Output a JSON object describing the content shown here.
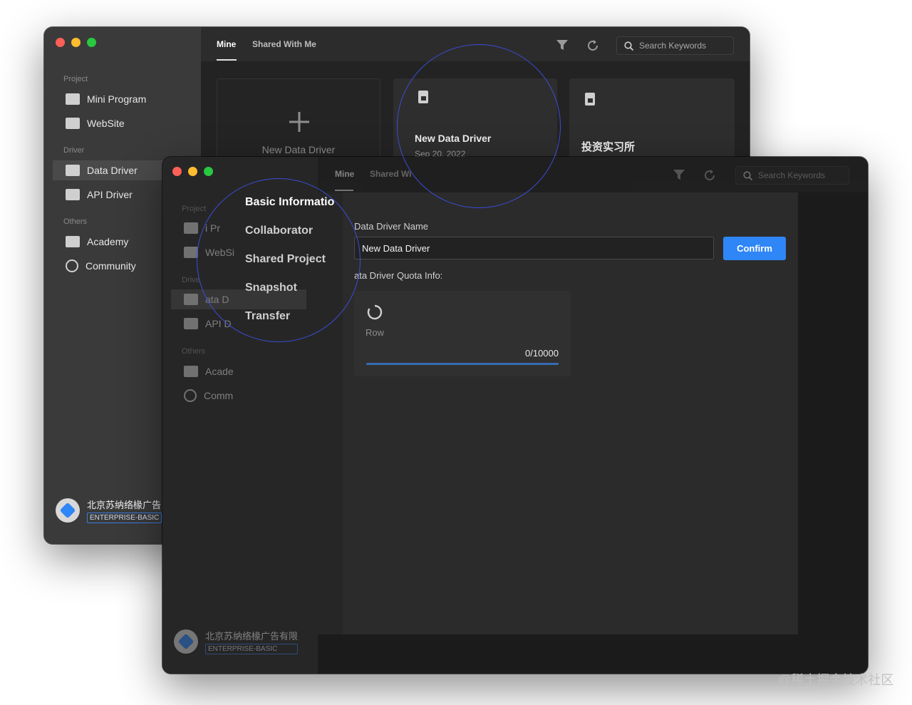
{
  "back_window": {
    "sidebar": {
      "sections": [
        {
          "title": "Project",
          "items": [
            {
              "label": "Mini Program",
              "icon": "mini-program-icon"
            },
            {
              "label": "WebSite",
              "icon": "website-icon"
            }
          ]
        },
        {
          "title": "Driver",
          "items": [
            {
              "label": "Data Driver",
              "icon": "data-driver-icon",
              "active": true
            },
            {
              "label": "API Driver",
              "icon": "api-driver-icon"
            }
          ]
        },
        {
          "title": "Others",
          "items": [
            {
              "label": "Academy",
              "icon": "academy-icon"
            },
            {
              "label": "Community",
              "icon": "community-icon"
            }
          ]
        }
      ],
      "brand": {
        "name": "北京苏纳络椽广告",
        "badge": "ENTERPRISE-BASIC"
      }
    },
    "tabs": [
      {
        "label": "Mine",
        "active": true
      },
      {
        "label": "Shared With Me"
      }
    ],
    "search_placeholder": "Search Keywords",
    "cards": {
      "new_card_label": "New Data Driver",
      "items": [
        {
          "title": "New Data Driver",
          "date": "Sep 20, 2022"
        },
        {
          "title": "投资实习所"
        }
      ]
    }
  },
  "front_window": {
    "sidebar": {
      "sections": [
        {
          "title": "Project",
          "items": [
            {
              "label": "i Pr"
            },
            {
              "label": "WebSi"
            }
          ]
        },
        {
          "title": "Drive",
          "items": [
            {
              "label": "ata D",
              "active": true
            },
            {
              "label": "API D"
            }
          ]
        },
        {
          "title": "Others",
          "items": [
            {
              "label": "Acade"
            },
            {
              "label": "Comm"
            }
          ]
        }
      ],
      "brand": {
        "name": "北京苏纳络椽广告有限",
        "badge": "ENTERPRISE-BASIC"
      }
    },
    "tabs": [
      {
        "label": "Mine",
        "active": true
      },
      {
        "label": "Shared Wi"
      }
    ],
    "search_placeholder": "Search Keywords",
    "menu": [
      {
        "label": "Basic Informatio",
        "selected": true
      },
      {
        "label": "Collaborator"
      },
      {
        "label": "Shared Project"
      },
      {
        "label": "Snapshot"
      },
      {
        "label": "Transfer"
      }
    ],
    "form": {
      "name_label": "Data Driver Name",
      "name_value": "New Data Driver",
      "confirm_label": "Confirm",
      "quota_label": "ata Driver Quota Info:",
      "quota": {
        "unit": "Row",
        "usage_text": "0/10000",
        "used": 0,
        "total": 10000
      }
    }
  },
  "watermark": "@稀土掘金技术社区",
  "colors": {
    "accent": "#2f86f6",
    "highlight_circle": "#3a4dd6"
  }
}
